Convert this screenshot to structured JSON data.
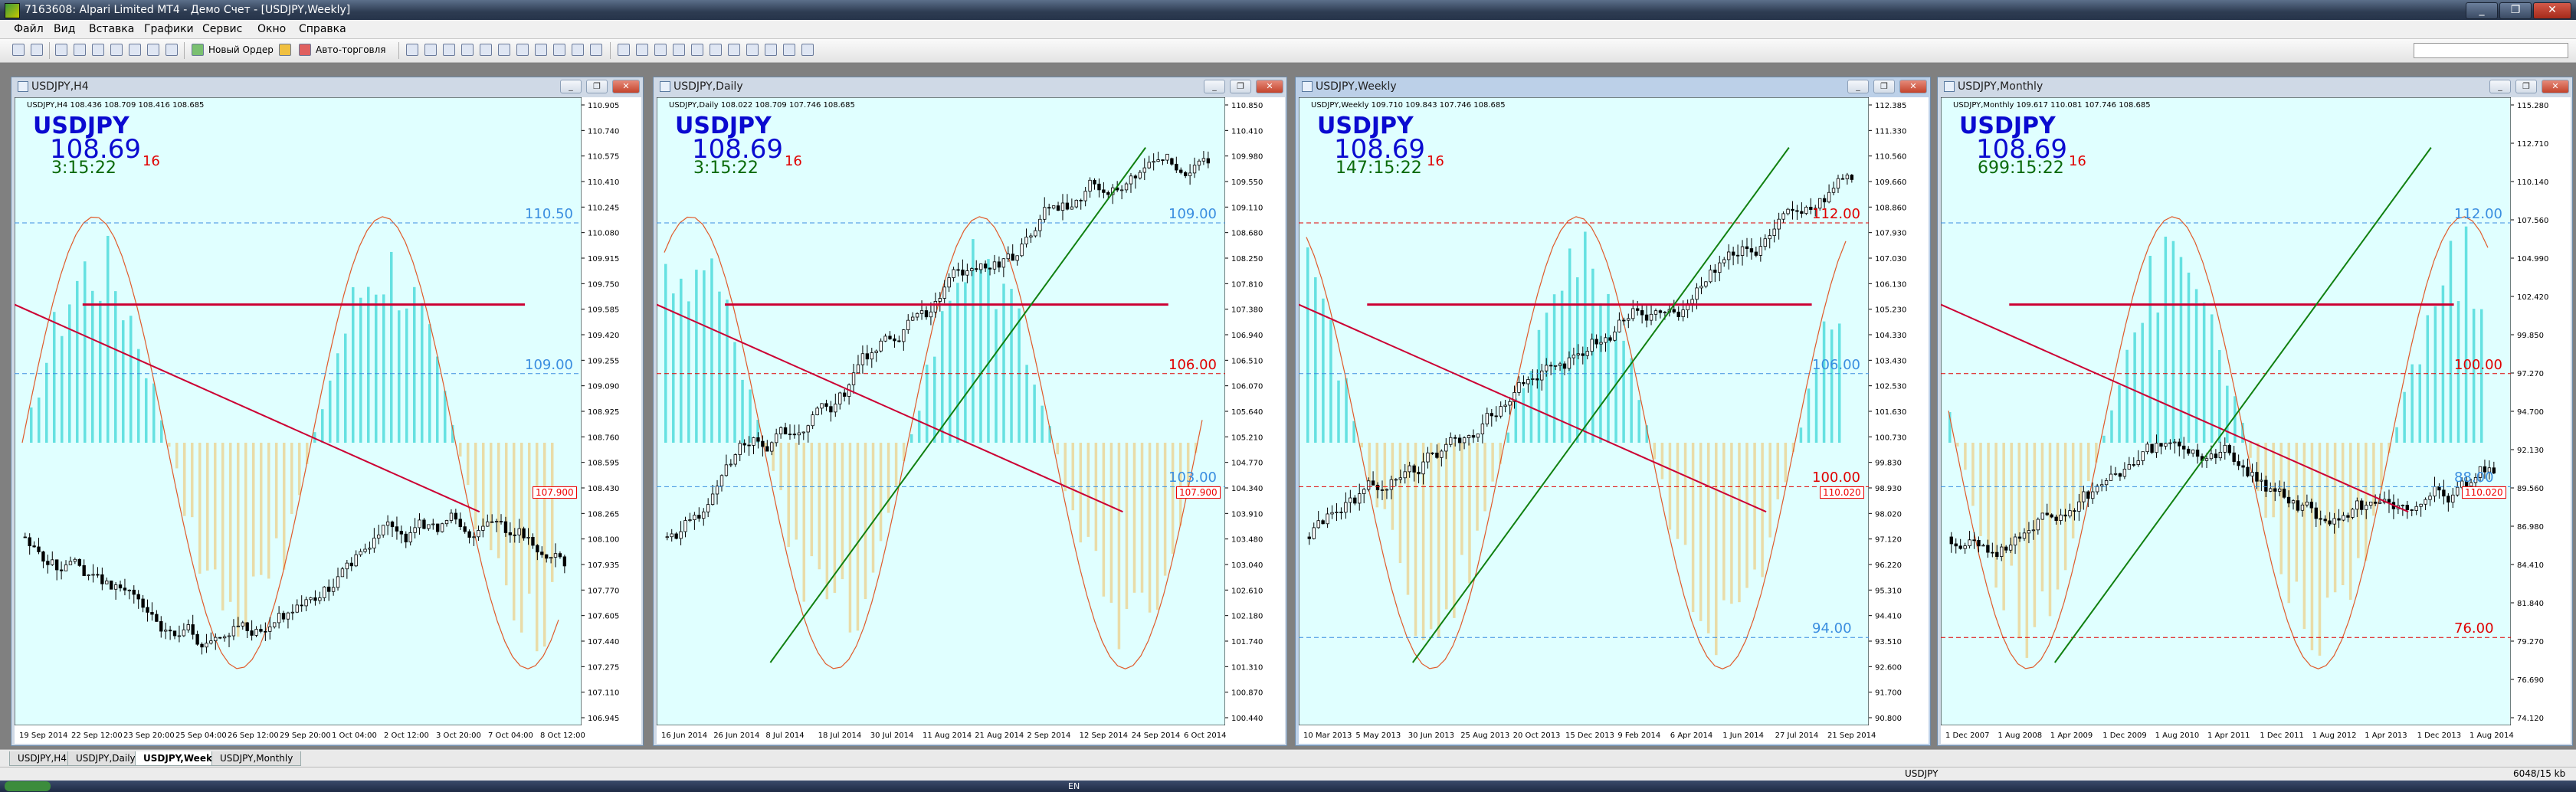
{
  "app": {
    "title": "7163608: Alpari Limited MT4 - Демо Счет - [USDJPY,Weekly]",
    "window_buttons": [
      "_",
      "❐",
      "✕"
    ]
  },
  "menu": [
    "Файл",
    "Вид",
    "Вставка",
    "Графики",
    "Сервис",
    "Окно",
    "Справка"
  ],
  "toolbar": {
    "new_order": "Новый Ордер",
    "auto_trading": "Авто-торговля"
  },
  "charts": [
    {
      "title": "USDJPY,H4",
      "info": "USDJPY,H4  108.436 108.709 108.416 108.685",
      "symbol": "USDJPY",
      "price_main": "108.69",
      "price_small": "16",
      "timer": "3:15:22",
      "levels": [
        {
          "text": "110.50",
          "color": "#3a8ee0"
        },
        {
          "text": "109.00",
          "color": "#3a8ee0"
        }
      ],
      "tag": "107.900",
      "yaxis": [
        "110.905",
        "110.740",
        "110.575",
        "110.410",
        "110.245",
        "110.080",
        "109.915",
        "109.750",
        "109.585",
        "109.420",
        "109.255",
        "109.090",
        "108.925",
        "108.760",
        "108.595",
        "108.430",
        "108.265",
        "108.100",
        "107.935",
        "107.770",
        "107.605",
        "107.440",
        "107.275",
        "107.110",
        "106.945"
      ],
      "xaxis": [
        "19 Sep 2014",
        "22 Sep 12:00",
        "23 Sep 20:00",
        "25 Sep 04:00",
        "26 Sep 12:00",
        "29 Sep 20:00",
        "1 Oct 04:00",
        "2 Oct 12:00",
        "3 Oct 20:00",
        "7 Oct 04:00",
        "8 Oct 12:00"
      ]
    },
    {
      "title": "USDJPY,Daily",
      "info": "USDJPY,Daily  108.022 108.709 107.746 108.685",
      "symbol": "USDJPY",
      "price_main": "108.69",
      "price_small": "16",
      "timer": "3:15:22",
      "levels": [
        {
          "text": "109.00",
          "color": "#3a8ee0"
        },
        {
          "text": "106.00",
          "color": "#e00000"
        },
        {
          "text": "103.00",
          "color": "#3a8ee0"
        }
      ],
      "tag": "107.900",
      "yaxis": [
        "110.850",
        "110.410",
        "109.980",
        "109.550",
        "109.110",
        "108.680",
        "108.250",
        "107.810",
        "107.380",
        "106.940",
        "106.510",
        "106.070",
        "105.640",
        "105.210",
        "104.770",
        "104.340",
        "103.910",
        "103.480",
        "103.040",
        "102.610",
        "102.180",
        "101.740",
        "101.310",
        "100.870",
        "100.440"
      ],
      "xaxis": [
        "16 Jun 2014",
        "26 Jun 2014",
        "8 Jul 2014",
        "18 Jul 2014",
        "30 Jul 2014",
        "11 Aug 2014",
        "21 Aug 2014",
        "2 Sep 2014",
        "12 Sep 2014",
        "24 Sep 2014",
        "6 Oct 2014"
      ]
    },
    {
      "title": "USDJPY,Weekly",
      "info": "USDJPY,Weekly  109.710 109.843 107.746 108.685",
      "symbol": "USDJPY",
      "price_main": "108.69",
      "price_small": "16",
      "timer": "147:15:22",
      "levels": [
        {
          "text": "112.00",
          "color": "#e00000"
        },
        {
          "text": "106.00",
          "color": "#3a8ee0"
        },
        {
          "text": "100.00",
          "color": "#e00000"
        },
        {
          "text": "94.00",
          "color": "#3a8ee0"
        }
      ],
      "tag": "110.020",
      "yaxis": [
        "112.385",
        "111.330",
        "110.560",
        "109.660",
        "108.860",
        "107.930",
        "107.030",
        "106.130",
        "105.230",
        "104.330",
        "103.430",
        "102.530",
        "101.630",
        "100.730",
        "99.830",
        "98.930",
        "98.020",
        "97.120",
        "96.220",
        "95.310",
        "94.410",
        "93.510",
        "92.600",
        "91.700",
        "90.800"
      ],
      "xaxis": [
        "10 Mar 2013",
        "5 May 2013",
        "30 Jun 2013",
        "25 Aug 2013",
        "20 Oct 2013",
        "15 Dec 2013",
        "9 Feb 2014",
        "6 Apr 2014",
        "1 Jun 2014",
        "27 Jul 2014",
        "21 Sep 2014"
      ]
    },
    {
      "title": "USDJPY,Monthly",
      "info": "USDJPY,Monthly  109.617 110.081 107.746 108.685",
      "symbol": "USDJPY",
      "price_main": "108.69",
      "price_small": "16",
      "timer": "699:15:22",
      "levels": [
        {
          "text": "112.00",
          "color": "#3a8ee0"
        },
        {
          "text": "100.00",
          "color": "#e00000"
        },
        {
          "text": "88.00",
          "color": "#3a8ee0"
        },
        {
          "text": "76.00",
          "color": "#e00000"
        }
      ],
      "tag": "110.020",
      "yaxis": [
        "115.280",
        "112.710",
        "110.140",
        "107.560",
        "104.990",
        "102.420",
        "99.850",
        "97.270",
        "94.700",
        "92.130",
        "89.560",
        "86.980",
        "84.410",
        "81.840",
        "79.270",
        "76.690",
        "74.120"
      ],
      "xaxis": [
        "1 Dec 2007",
        "1 Aug 2008",
        "1 Apr 2009",
        "1 Dec 2009",
        "1 Aug 2010",
        "1 Apr 2011",
        "1 Dec 2011",
        "1 Aug 2012",
        "1 Apr 2013",
        "1 Dec 2013",
        "1 Aug 2014"
      ]
    }
  ],
  "tabs": [
    "USDJPY,H4",
    "USDJPY,Daily",
    "USDJPY,Weekly",
    "USDJPY,Monthly"
  ],
  "status": {
    "symbol": "USDJPY",
    "traffic": "6048/15 kb"
  },
  "taskbar": {
    "lang": "EN"
  },
  "colors": {
    "chart_bg": "#e0ffff",
    "bull_fill": "#00c8c8",
    "bear_fill": "#f0c060",
    "trend_red": "#cc0033",
    "trend_green": "#108010"
  }
}
